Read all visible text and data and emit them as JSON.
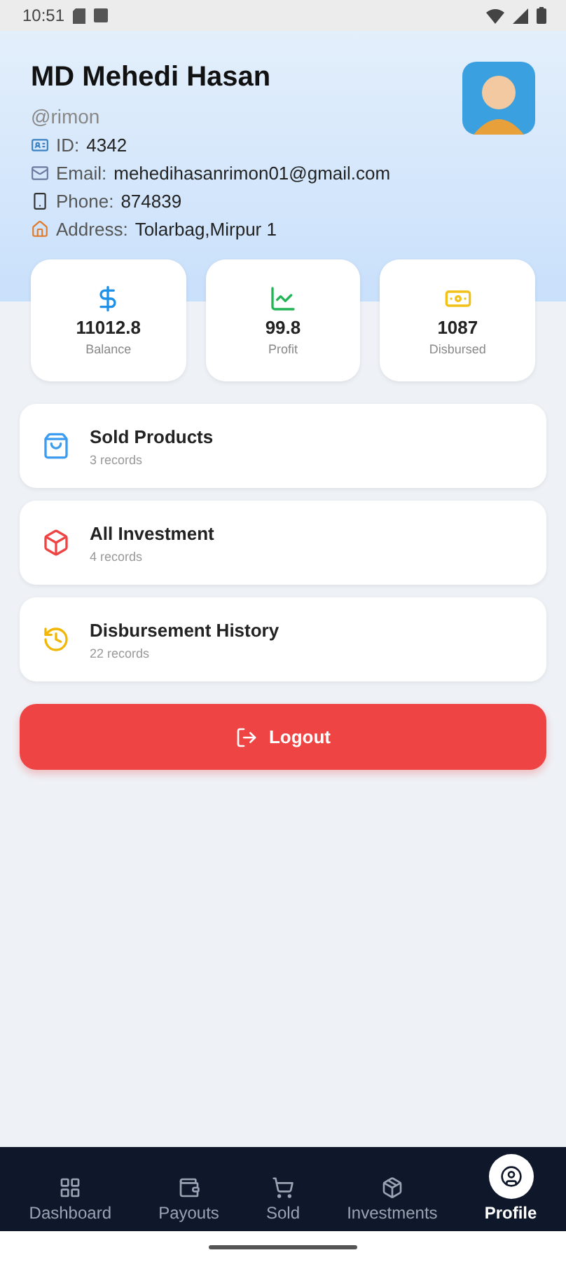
{
  "status_bar": {
    "time": "10:51"
  },
  "profile": {
    "name": "MD Mehedi Hasan",
    "username": "@rimon",
    "details": [
      {
        "kind": "id",
        "label": "ID:",
        "value": "4342"
      },
      {
        "kind": "email",
        "label": "Email:",
        "value": "mehedihasanrimon01@gmail.com"
      },
      {
        "kind": "phone",
        "label": "Phone:",
        "value": "874839"
      },
      {
        "kind": "address",
        "label": "Address:",
        "value": "Tolarbag,Mirpur 1"
      }
    ]
  },
  "stats": [
    {
      "kind": "balance",
      "value": "11012.8",
      "label": "Balance"
    },
    {
      "kind": "profit",
      "value": "99.8",
      "label": "Profit"
    },
    {
      "kind": "disbursed",
      "value": "1087",
      "label": "Disbursed"
    }
  ],
  "records": [
    {
      "kind": "sold",
      "title": "Sold Products",
      "count": "3 records"
    },
    {
      "kind": "investment",
      "title": "All Investment",
      "count": "4 records"
    },
    {
      "kind": "history",
      "title": "Disbursement History",
      "count": "22 records"
    }
  ],
  "logout_button": "Logout",
  "nav": [
    {
      "kind": "dashboard",
      "label": "Dashboard",
      "selected": false
    },
    {
      "kind": "payouts",
      "label": "Payouts",
      "selected": false
    },
    {
      "kind": "sold",
      "label": "Sold",
      "selected": false
    },
    {
      "kind": "investments",
      "label": "Investments",
      "selected": false
    },
    {
      "kind": "profile",
      "label": "Profile",
      "selected": true
    }
  ]
}
